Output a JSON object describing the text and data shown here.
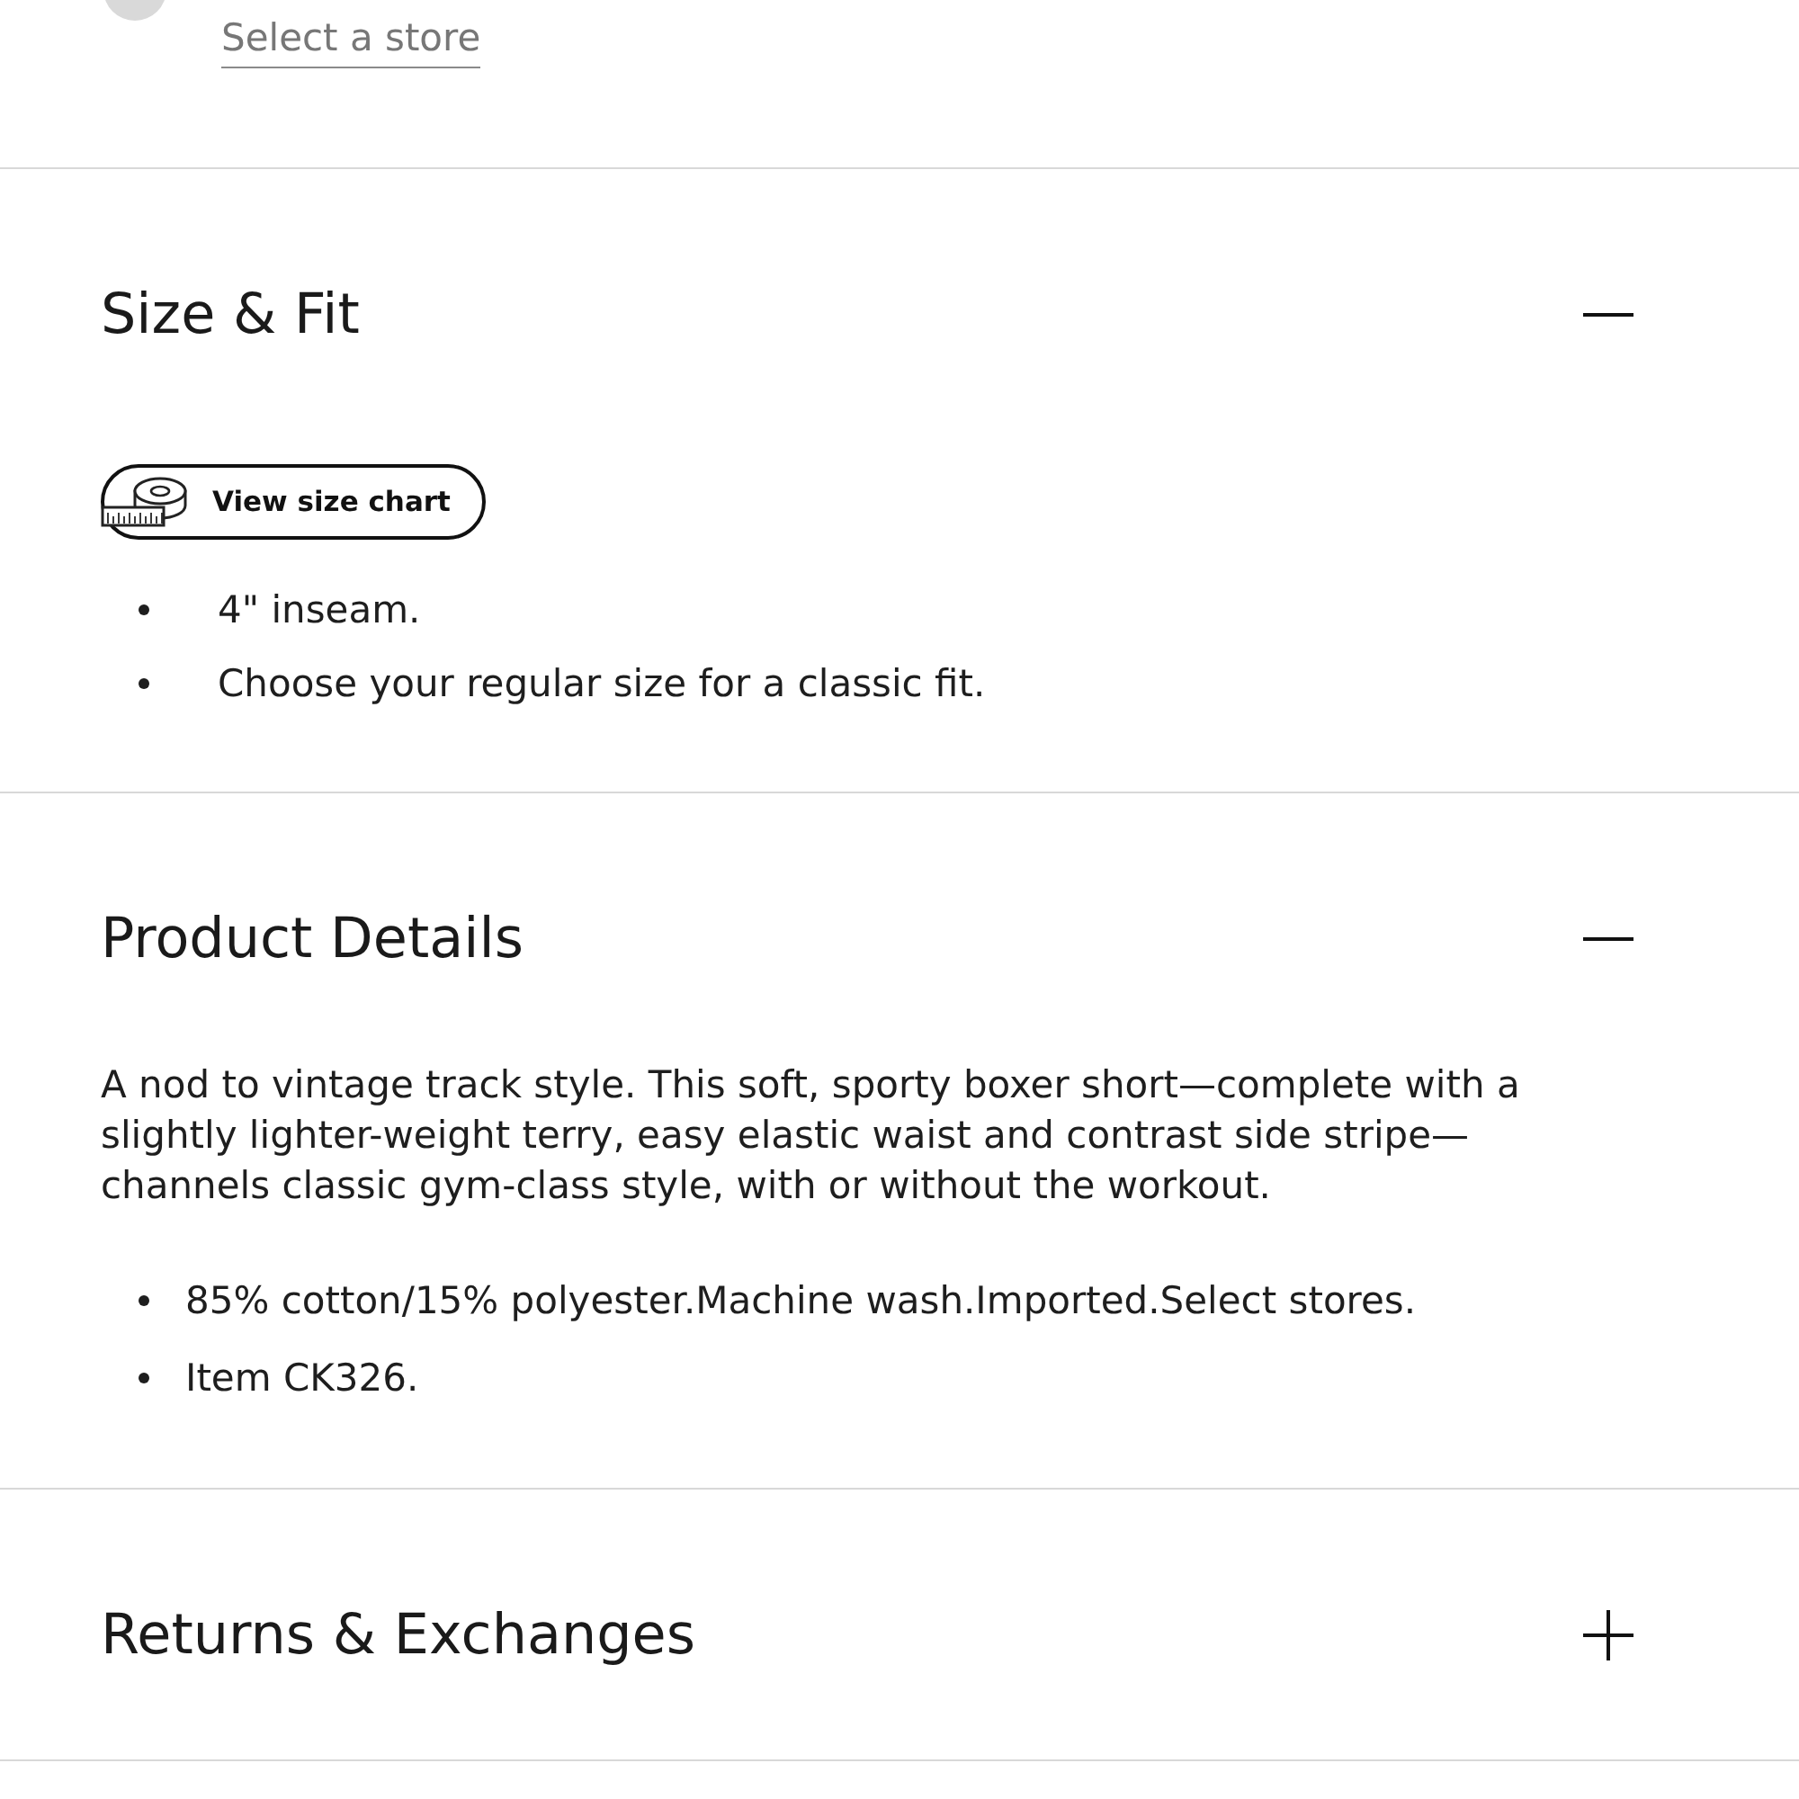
{
  "pickup_option": {
    "selected": false,
    "link": "Select a store"
  },
  "sections": [
    {
      "title": "Size & Fit",
      "expanded": true,
      "size_chart_button": "View size chart",
      "bullets": [
        "4\" inseam.",
        "Choose your regular size for a classic fit."
      ]
    },
    {
      "title": "Product Details",
      "expanded": true,
      "description": "A nod to vintage track style. This soft, sporty boxer short—complete with a slightly lighter-weight terry, easy elastic waist and contrast side stripe—channels classic gym-class style, with or without the workout.",
      "bullets": [
        "85% cotton/15% polyester.Machine wash.Imported.Select stores.",
        "Item CK326."
      ]
    },
    {
      "title": "Returns & Exchanges",
      "expanded": false
    }
  ]
}
